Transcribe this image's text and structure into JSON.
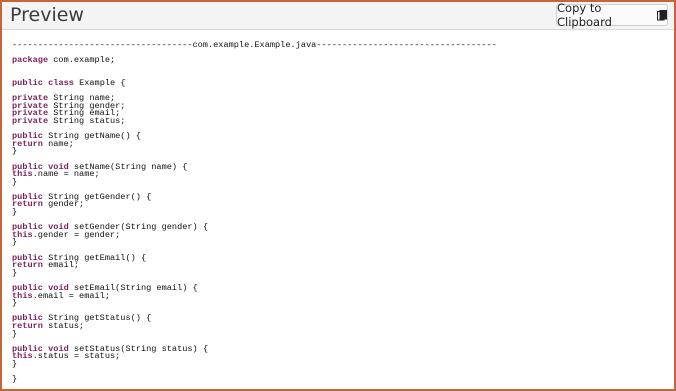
{
  "header": {
    "title": "Preview",
    "copy_button_label": "Copy to Clipboard",
    "copy_icon": "clipboard-icon"
  },
  "code": {
    "language": "java",
    "lines": [
      [
        {
          "t": "-----------------------------------com.example.Example.java-----------------------------------"
        }
      ],
      [],
      [
        {
          "t": "package",
          "k": 1
        },
        {
          "t": " com.example;"
        }
      ],
      [],
      [],
      [
        {
          "t": "public",
          "k": 1
        },
        {
          "t": " "
        },
        {
          "t": "class",
          "k": 1
        },
        {
          "t": " Example {"
        }
      ],
      [],
      [
        {
          "t": "private",
          "k": 1
        },
        {
          "t": " String name;"
        }
      ],
      [
        {
          "t": "private",
          "k": 1
        },
        {
          "t": " String gender;"
        }
      ],
      [
        {
          "t": "private",
          "k": 1
        },
        {
          "t": " String email;"
        }
      ],
      [
        {
          "t": "private",
          "k": 1
        },
        {
          "t": " String status;"
        }
      ],
      [],
      [
        {
          "t": "public",
          "k": 1
        },
        {
          "t": " String getName() {"
        }
      ],
      [
        {
          "t": "return",
          "k": 1
        },
        {
          "t": " name;"
        }
      ],
      [
        {
          "t": "}"
        }
      ],
      [],
      [
        {
          "t": "public",
          "k": 1
        },
        {
          "t": " "
        },
        {
          "t": "void",
          "k": 1
        },
        {
          "t": " setName(String name) {"
        }
      ],
      [
        {
          "t": "this",
          "k": 1
        },
        {
          "t": ".name = name;"
        }
      ],
      [
        {
          "t": "}"
        }
      ],
      [],
      [
        {
          "t": "public",
          "k": 1
        },
        {
          "t": " String getGender() {"
        }
      ],
      [
        {
          "t": "return",
          "k": 1
        },
        {
          "t": " gender;"
        }
      ],
      [
        {
          "t": "}"
        }
      ],
      [],
      [
        {
          "t": "public",
          "k": 1
        },
        {
          "t": " "
        },
        {
          "t": "void",
          "k": 1
        },
        {
          "t": " setGender(String gender) {"
        }
      ],
      [
        {
          "t": "this",
          "k": 1
        },
        {
          "t": ".gender = gender;"
        }
      ],
      [
        {
          "t": "}"
        }
      ],
      [],
      [
        {
          "t": "public",
          "k": 1
        },
        {
          "t": " String getEmail() {"
        }
      ],
      [
        {
          "t": "return",
          "k": 1
        },
        {
          "t": " email;"
        }
      ],
      [
        {
          "t": "}"
        }
      ],
      [],
      [
        {
          "t": "public",
          "k": 1
        },
        {
          "t": " "
        },
        {
          "t": "void",
          "k": 1
        },
        {
          "t": " setEmail(String email) {"
        }
      ],
      [
        {
          "t": "this",
          "k": 1
        },
        {
          "t": ".email = email;"
        }
      ],
      [
        {
          "t": "}"
        }
      ],
      [],
      [
        {
          "t": "public",
          "k": 1
        },
        {
          "t": " String getStatus() {"
        }
      ],
      [
        {
          "t": "return",
          "k": 1
        },
        {
          "t": " status;"
        }
      ],
      [
        {
          "t": "}"
        }
      ],
      [],
      [
        {
          "t": "public",
          "k": 1
        },
        {
          "t": " "
        },
        {
          "t": "void",
          "k": 1
        },
        {
          "t": " setStatus(String status) {"
        }
      ],
      [
        {
          "t": "this",
          "k": 1
        },
        {
          "t": ".status = status;"
        }
      ],
      [
        {
          "t": "}"
        }
      ],
      [],
      [
        {
          "t": "}"
        }
      ]
    ]
  },
  "colors": {
    "frame_border": "#c8643a",
    "keyword": "#7a1f5c",
    "header_bg": "#f4f4f4"
  }
}
